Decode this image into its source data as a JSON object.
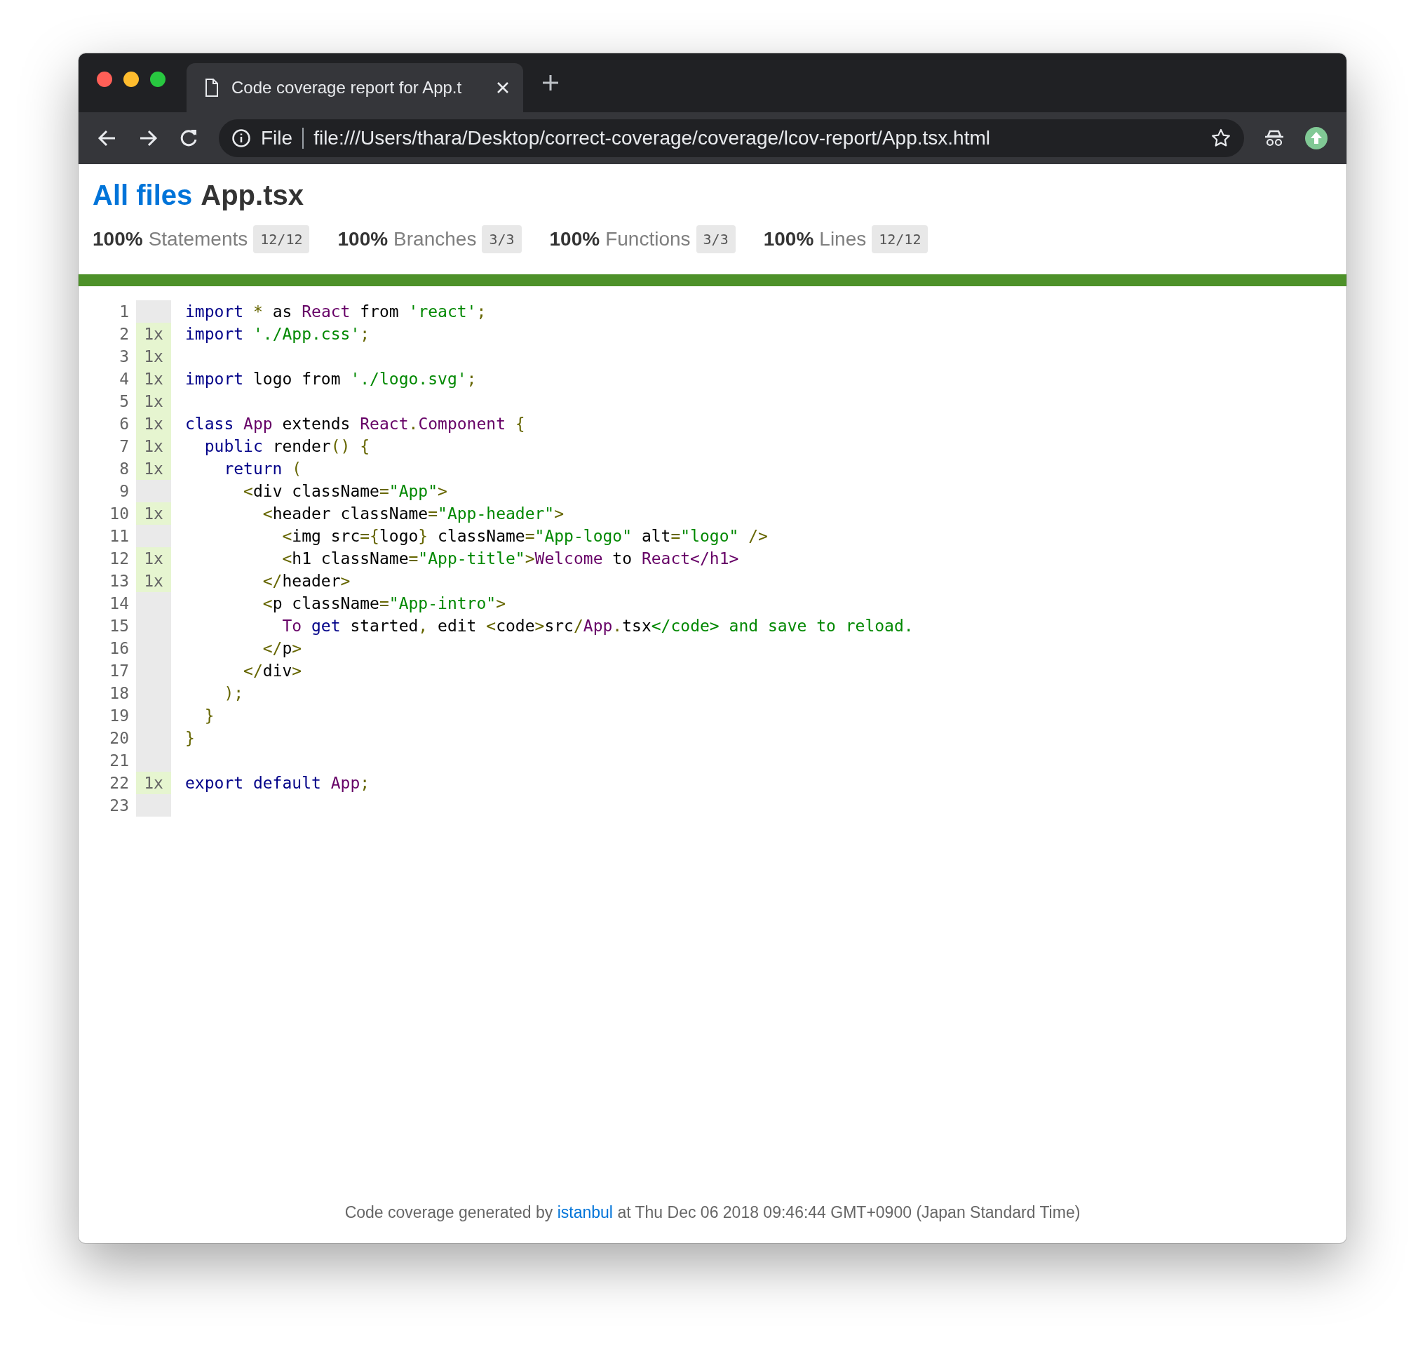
{
  "browser": {
    "tab_title": "Code coverage report for App.t",
    "address_label": "File",
    "url": "file:///Users/thara/Desktop/correct-coverage/coverage/lcov-report/App.tsx.html"
  },
  "header": {
    "breadcrumb_link": "All files",
    "file_name": "App.tsx"
  },
  "stats": [
    {
      "percent": "100%",
      "label": "Statements",
      "fraction": "12/12"
    },
    {
      "percent": "100%",
      "label": "Branches",
      "fraction": "3/3"
    },
    {
      "percent": "100%",
      "label": "Functions",
      "fraction": "3/3"
    },
    {
      "percent": "100%",
      "label": "Lines",
      "fraction": "12/12"
    }
  ],
  "lines": [
    {
      "number": "1",
      "covered": false,
      "tokens": [
        {
          "kind": "kwd",
          "text": "import"
        },
        {
          "kind": "pun",
          "text": " *"
        },
        {
          "kind": "pln",
          "text": " as "
        },
        {
          "kind": "typ",
          "text": "React"
        },
        {
          "kind": "pln",
          "text": " from "
        },
        {
          "kind": "str",
          "text": "'react'"
        },
        {
          "kind": "pun",
          "text": ";"
        }
      ]
    },
    {
      "number": "2",
      "covered": true,
      "count": "1x",
      "tokens": [
        {
          "kind": "kwd",
          "text": "import"
        },
        {
          "kind": "str",
          "text": " './App.css'"
        },
        {
          "kind": "pun",
          "text": ";"
        }
      ]
    },
    {
      "number": "3",
      "covered": true,
      "count": "1x"
    },
    {
      "number": "4",
      "covered": true,
      "count": "1x",
      "tokens": [
        {
          "kind": "kwd",
          "text": "import"
        },
        {
          "kind": "pln",
          "text": " logo from "
        },
        {
          "kind": "str",
          "text": "'./logo.svg'"
        },
        {
          "kind": "pun",
          "text": ";"
        }
      ]
    },
    {
      "number": "5",
      "covered": true,
      "count": "1x"
    },
    {
      "number": "6",
      "covered": true,
      "count": "1x",
      "tokens": [
        {
          "kind": "kwd",
          "text": "class"
        },
        {
          "kind": "typ",
          "text": " App"
        },
        {
          "kind": "pln",
          "text": " extends "
        },
        {
          "kind": "typ",
          "text": "React"
        },
        {
          "kind": "pun",
          "text": "."
        },
        {
          "kind": "typ",
          "text": "Component"
        },
        {
          "kind": "pun",
          "text": " {"
        }
      ]
    },
    {
      "number": "7",
      "covered": true,
      "count": "1x",
      "tokens": [
        {
          "kind": "kwd",
          "text": "  public"
        },
        {
          "kind": "pln",
          "text": " render"
        },
        {
          "kind": "pun",
          "text": "() {"
        }
      ]
    },
    {
      "number": "8",
      "covered": true,
      "count": "1x",
      "tokens": [
        {
          "kind": "kwd",
          "text": "    return"
        },
        {
          "kind": "pun",
          "text": " ("
        }
      ]
    },
    {
      "number": "9",
      "covered": false,
      "tokens": [
        {
          "kind": "pun",
          "text": "      <"
        },
        {
          "kind": "pln",
          "text": "div className"
        },
        {
          "kind": "pun",
          "text": "="
        },
        {
          "kind": "str",
          "text": "\"App\""
        },
        {
          "kind": "pun",
          "text": ">"
        }
      ]
    },
    {
      "number": "10",
      "covered": true,
      "count": "1x",
      "tokens": [
        {
          "kind": "pun",
          "text": "        <"
        },
        {
          "kind": "pln",
          "text": "header className"
        },
        {
          "kind": "pun",
          "text": "="
        },
        {
          "kind": "str",
          "text": "\"App-header\""
        },
        {
          "kind": "pun",
          "text": ">"
        }
      ]
    },
    {
      "number": "11",
      "covered": false,
      "tokens": [
        {
          "kind": "pun",
          "text": "          <"
        },
        {
          "kind": "pln",
          "text": "img src"
        },
        {
          "kind": "pun",
          "text": "={"
        },
        {
          "kind": "pln",
          "text": "logo"
        },
        {
          "kind": "pun",
          "text": "}"
        },
        {
          "kind": "pln",
          "text": " className"
        },
        {
          "kind": "pun",
          "text": "="
        },
        {
          "kind": "str",
          "text": "\"App-logo\""
        },
        {
          "kind": "pln",
          "text": " alt"
        },
        {
          "kind": "pun",
          "text": "="
        },
        {
          "kind": "str",
          "text": "\"logo\""
        },
        {
          "kind": "pun",
          "text": " />"
        }
      ]
    },
    {
      "number": "12",
      "covered": true,
      "count": "1x",
      "tokens": [
        {
          "kind": "pun",
          "text": "          <"
        },
        {
          "kind": "pln",
          "text": "h1 className"
        },
        {
          "kind": "pun",
          "text": "="
        },
        {
          "kind": "str",
          "text": "\"App-title\""
        },
        {
          "kind": "pun",
          "text": ">"
        },
        {
          "kind": "typ",
          "text": "Welcome"
        },
        {
          "kind": "pln",
          "text": " to "
        },
        {
          "kind": "typ",
          "text": "React</h1>"
        }
      ]
    },
    {
      "number": "13",
      "covered": true,
      "count": "1x",
      "tokens": [
        {
          "kind": "pun",
          "text": "        </"
        },
        {
          "kind": "pln",
          "text": "header"
        },
        {
          "kind": "pun",
          "text": ">"
        }
      ]
    },
    {
      "number": "14",
      "covered": false,
      "tokens": [
        {
          "kind": "pun",
          "text": "        <"
        },
        {
          "kind": "pln",
          "text": "p className"
        },
        {
          "kind": "pun",
          "text": "="
        },
        {
          "kind": "str",
          "text": "\"App-intro\""
        },
        {
          "kind": "pun",
          "text": ">"
        }
      ]
    },
    {
      "number": "15",
      "covered": false,
      "tokens": [
        {
          "kind": "typ",
          "text": "          To"
        },
        {
          "kind": "kwd",
          "text": " get"
        },
        {
          "kind": "pln",
          "text": " started"
        },
        {
          "kind": "pun",
          "text": ","
        },
        {
          "kind": "pln",
          "text": " edit "
        },
        {
          "kind": "pun",
          "text": "<"
        },
        {
          "kind": "pln",
          "text": "code"
        },
        {
          "kind": "pun",
          "text": ">"
        },
        {
          "kind": "pln",
          "text": "src"
        },
        {
          "kind": "pun",
          "text": "/"
        },
        {
          "kind": "typ",
          "text": "App"
        },
        {
          "kind": "pun",
          "text": "."
        },
        {
          "kind": "pln",
          "text": "tsx"
        },
        {
          "kind": "str",
          "text": "</code> and save to reload."
        }
      ]
    },
    {
      "number": "16",
      "covered": false,
      "tokens": [
        {
          "kind": "pun",
          "text": "        </"
        },
        {
          "kind": "pln",
          "text": "p"
        },
        {
          "kind": "pun",
          "text": ">"
        }
      ]
    },
    {
      "number": "17",
      "covered": false,
      "tokens": [
        {
          "kind": "pun",
          "text": "      </"
        },
        {
          "kind": "pln",
          "text": "div"
        },
        {
          "kind": "pun",
          "text": ">"
        }
      ]
    },
    {
      "number": "18",
      "covered": false,
      "tokens": [
        {
          "kind": "pun",
          "text": "    );"
        }
      ]
    },
    {
      "number": "19",
      "covered": false,
      "tokens": [
        {
          "kind": "pun",
          "text": "  }"
        }
      ]
    },
    {
      "number": "20",
      "covered": false,
      "tokens": [
        {
          "kind": "pun",
          "text": "}"
        }
      ]
    },
    {
      "number": "21",
      "covered": false
    },
    {
      "number": "22",
      "covered": true,
      "count": "1x",
      "tokens": [
        {
          "kind": "kwd",
          "text": "export default"
        },
        {
          "kind": "typ",
          "text": " App"
        },
        {
          "kind": "pun",
          "text": ";"
        }
      ]
    },
    {
      "number": "23",
      "covered": false
    }
  ],
  "footer": {
    "before": "Code coverage generated by",
    "link": "istanbul",
    "after": "at Thu Dec 06 2018 09:46:44 GMT+0900 (Japan Standard Time)"
  }
}
